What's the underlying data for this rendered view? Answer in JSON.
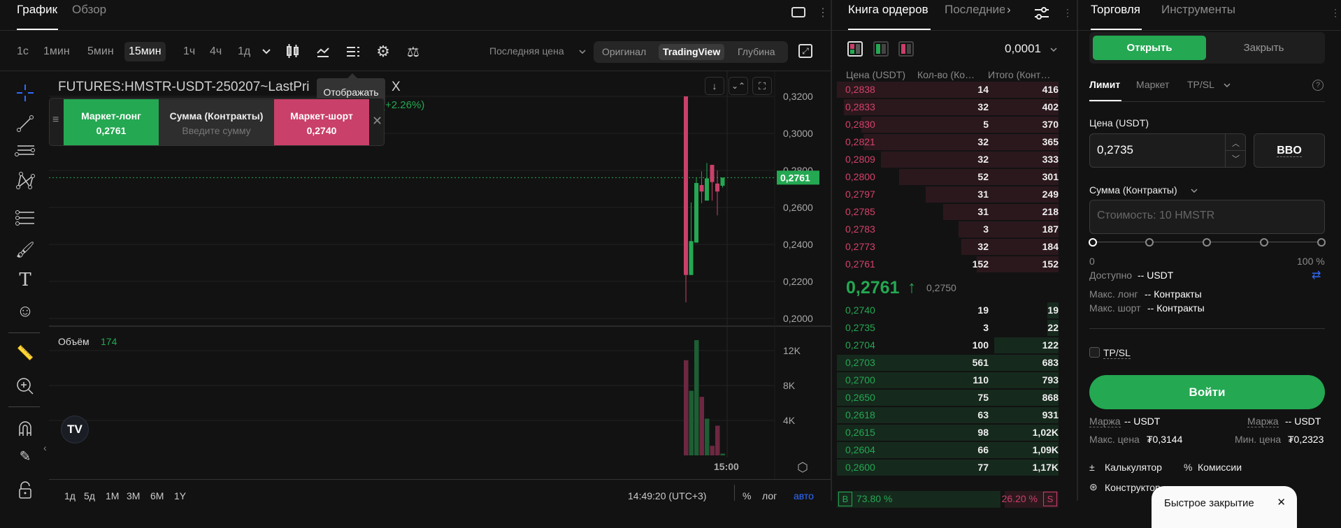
{
  "chart_tabs": [
    "График",
    "Обзор"
  ],
  "timeframes": [
    "1с",
    "1мин",
    "5мин",
    "15мин",
    "1ч",
    "4ч",
    "1д"
  ],
  "active_timeframe": "15мин",
  "price_source": "Последняя цена",
  "view_modes": [
    "Оригинал",
    "TradingView",
    "Глубина"
  ],
  "active_view": "TradingView",
  "tooltip": "Отображать",
  "symbol_title": "FUTURES:HMSTR-USDT-250207~LastPri",
  "symbol_title_tail": "X",
  "change_pct": "(+2.26%)",
  "quick_trade": {
    "long_label": "Маркет-лонг",
    "long_price": "0,2761",
    "amount_label": "Сумма (Контракты)",
    "amount_placeholder": "Введите сумму",
    "short_label": "Маркет-шорт",
    "short_price": "0,2740"
  },
  "volume_label": "Объём",
  "volume_value": "174",
  "time_label": "15:00",
  "range_buttons": [
    "1д",
    "5д",
    "1М",
    "3М",
    "6М",
    "1Y"
  ],
  "clock": "14:49:20 (UTC+3)",
  "scale_opts": [
    "%",
    "лог",
    "авто"
  ],
  "chart_data": {
    "type": "candlestick",
    "price_ticks": [
      "0,3200",
      "0,3000",
      "0,2800",
      "0,2600",
      "0,2400",
      "0,2200",
      "0,2000"
    ],
    "price_tick_values": [
      0.32,
      0.3,
      0.28,
      0.26,
      0.24,
      0.22,
      0.2
    ],
    "ylim": [
      0.2,
      0.32
    ],
    "last_price": 0.2761,
    "last_price_label": "0,2761",
    "candles": [
      {
        "o": 0.32,
        "h": 0.32,
        "l": 0.2087,
        "c": 0.2235
      },
      {
        "o": 0.2235,
        "h": 0.2627,
        "l": 0.2235,
        "c": 0.2418
      },
      {
        "o": 0.241,
        "h": 0.276,
        "l": 0.241,
        "c": 0.2732
      },
      {
        "o": 0.2721,
        "h": 0.2795,
        "l": 0.2623,
        "c": 0.2686
      },
      {
        "o": 0.2637,
        "h": 0.284,
        "l": 0.2637,
        "c": 0.2757
      },
      {
        "o": 0.283,
        "h": 0.283,
        "l": 0.2637,
        "c": 0.2737
      },
      {
        "o": 0.2729,
        "h": 0.28,
        "l": 0.2557,
        "c": 0.2686
      },
      {
        "o": 0.2717,
        "h": 0.2761,
        "l": 0.2707,
        "c": 0.2761
      }
    ],
    "volume_ticks": [
      "12K",
      "8K",
      "4K"
    ],
    "volume_tick_values": [
      12000,
      8000,
      4000
    ],
    "volumes": [
      10900,
      7400,
      13200,
      6700,
      4200,
      1100,
      3400,
      200
    ]
  },
  "orderbook": {
    "tabs": [
      "Книга ордеров",
      "Последние"
    ],
    "precision": "0,0001",
    "headers": [
      "Цена (USDT)",
      "Кол-во (Ко…",
      "Итого (Конт…"
    ],
    "asks": [
      {
        "p": "0,2838",
        "q": "14",
        "t": "416",
        "d": 1.0
      },
      {
        "p": "0,2833",
        "q": "32",
        "t": "402",
        "d": 0.97
      },
      {
        "p": "0,2830",
        "q": "5",
        "t": "370",
        "d": 0.89
      },
      {
        "p": "0,2821",
        "q": "32",
        "t": "365",
        "d": 0.88
      },
      {
        "p": "0,2809",
        "q": "32",
        "t": "333",
        "d": 0.8
      },
      {
        "p": "0,2800",
        "q": "52",
        "t": "301",
        "d": 0.72
      },
      {
        "p": "0,2797",
        "q": "31",
        "t": "249",
        "d": 0.6
      },
      {
        "p": "0,2785",
        "q": "31",
        "t": "218",
        "d": 0.52
      },
      {
        "p": "0,2783",
        "q": "3",
        "t": "187",
        "d": 0.45
      },
      {
        "p": "0,2773",
        "q": "32",
        "t": "184",
        "d": 0.44
      },
      {
        "p": "0,2761",
        "q": "152",
        "t": "152",
        "d": 0.37
      }
    ],
    "mid_price": "0,2761",
    "mid_arrow": "↑",
    "mark_price": "0,2750",
    "bids": [
      {
        "p": "0,2740",
        "q": "19",
        "t": "19",
        "d": 0.05
      },
      {
        "p": "0,2735",
        "q": "3",
        "t": "22",
        "d": 0.05
      },
      {
        "p": "0,2704",
        "q": "100",
        "t": "122",
        "d": 0.29
      },
      {
        "p": "0,2703",
        "q": "561",
        "t": "683",
        "d": 1.0
      },
      {
        "p": "0,2700",
        "q": "110",
        "t": "793",
        "d": 1.0
      },
      {
        "p": "0,2650",
        "q": "75",
        "t": "868",
        "d": 1.0
      },
      {
        "p": "0,2618",
        "q": "63",
        "t": "931",
        "d": 1.0
      },
      {
        "p": "0,2615",
        "q": "98",
        "t": "1,02K",
        "d": 1.0
      },
      {
        "p": "0,2604",
        "q": "66",
        "t": "1,09K",
        "d": 1.0
      },
      {
        "p": "0,2600",
        "q": "77",
        "t": "1,17K",
        "d": 1.0
      }
    ],
    "buy_label": "B",
    "buy_pct": "73.80 %",
    "sell_pct": "26.20 %",
    "sell_label": "S",
    "buy_ratio": 0.738
  },
  "trade": {
    "tabs": [
      "Торговля",
      "Инструменты"
    ],
    "open": "Открыть",
    "close": "Закрыть",
    "order_types": [
      "Лимит",
      "Маркет",
      "TP/SL"
    ],
    "price_label": "Цена (USDT)",
    "price_value": "0,2735",
    "bbo": "BBO",
    "amount_label": "Сумма (Контракты)",
    "amount_placeholder": "Стоимость: 10 HMSTR",
    "slider_min": "0",
    "slider_max": "100 %",
    "slider_value": 0,
    "available_label": "Доступно",
    "available_value": "-- USDT",
    "max_long_label": "Макс. лонг",
    "max_long_value": "-- Контракты",
    "max_short_label": "Макс. шорт",
    "max_short_value": "-- Контракты",
    "tpsl": "TP/SL",
    "submit": "Войти",
    "margin_label": "Маржа",
    "margin_value": "-- USDT",
    "max_price_label": "Макс. цена",
    "max_price_value": "₮0,3144",
    "min_price_label": "Мин. цена",
    "min_price_value": "₮0,2323",
    "calculator": "Калькулятор",
    "fees": "Комиссии",
    "builder": "Конструктор",
    "popup_text": "Быстрое закрытие"
  },
  "colors": {
    "green": "#24a852",
    "red": "#c9406a",
    "blue": "#2f6bff",
    "bg": "#121212"
  }
}
